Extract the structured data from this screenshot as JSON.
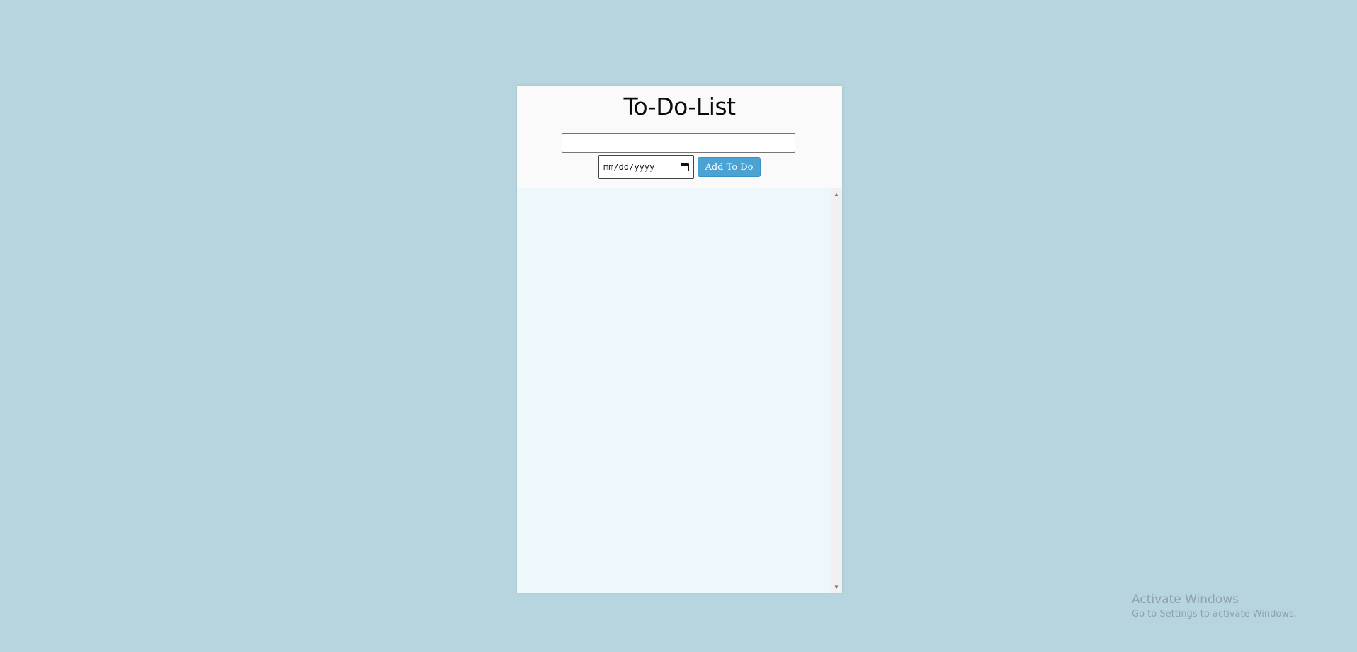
{
  "app": {
    "title": "To-Do-List",
    "task_input": {
      "value": "",
      "placeholder": ""
    },
    "date_input": {
      "value": "mm/dd/yyyy",
      "icon": "calendar-icon"
    },
    "add_button_label": "Add To Do",
    "todos": []
  },
  "scrollbar": {
    "up_arrow": "▲",
    "down_arrow": "▼"
  },
  "watermark": {
    "title": "Activate Windows",
    "subtitle": "Go to Settings to activate Windows."
  },
  "colors": {
    "page_background": "#b7d5de",
    "card_background": "#fafafa",
    "list_background": "#edf8fd",
    "button_accent": "#4aa3d3"
  }
}
